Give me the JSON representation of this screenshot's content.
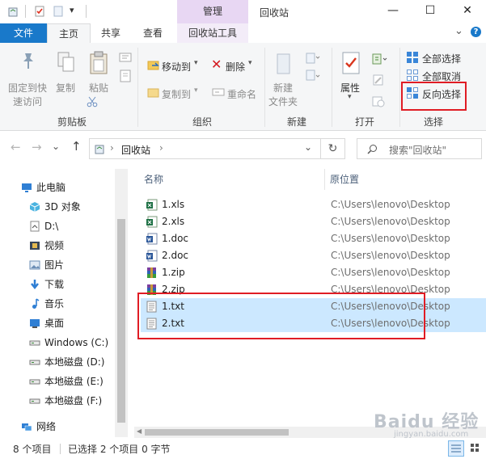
{
  "titlebar": {
    "manage_tab": "管理",
    "window_title": "回收站",
    "dropdown_glyph": "▾",
    "minimize": "—",
    "maximize": "☐",
    "close": "✕"
  },
  "ribbon_tabs": {
    "file": "文件",
    "home": "主页",
    "share": "共享",
    "view": "查看",
    "recycle_tools": "回收站工具",
    "expand_glyph": "⌄",
    "help_glyph": "?"
  },
  "ribbon": {
    "clipboard": {
      "pin": [
        "固定到快",
        "速访问"
      ],
      "copy": "复制",
      "paste": "粘贴",
      "group_label": "剪贴板"
    },
    "organize": {
      "move_to": "移动到",
      "copy_to": "复制到",
      "delete": "删除",
      "rename": "重命名",
      "group_label": "组织"
    },
    "new": {
      "new_folder": [
        "新建",
        "文件夹"
      ],
      "group_label": "新建"
    },
    "open": {
      "properties": "属性",
      "group_label": "打开"
    },
    "select": {
      "select_all": "全部选择",
      "select_none": "全部取消",
      "invert": "反向选择",
      "group_label": "选择"
    }
  },
  "address": {
    "back": "←",
    "forward": "→",
    "recent": "⌄",
    "up": "↑",
    "breadcrumb_sep": "›",
    "location": "回收站",
    "breadcrumb_end": "›",
    "history_dropdown": "⌄",
    "refresh": "↻",
    "search_placeholder": "搜索\"回收站\""
  },
  "nav": {
    "items": [
      {
        "label": "此电脑",
        "icon": "computer-icon"
      },
      {
        "label": "3D 对象",
        "icon": "3d-objects-icon"
      },
      {
        "label": "D:\\",
        "icon": "drive-shortcut-icon"
      },
      {
        "label": "视频",
        "icon": "videos-icon"
      },
      {
        "label": "图片",
        "icon": "pictures-icon"
      },
      {
        "label": "下载",
        "icon": "downloads-icon"
      },
      {
        "label": "音乐",
        "icon": "music-icon"
      },
      {
        "label": "桌面",
        "icon": "desktop-icon"
      },
      {
        "label": "Windows (C:)",
        "icon": "drive-icon"
      },
      {
        "label": "本地磁盘 (D:)",
        "icon": "drive-icon"
      },
      {
        "label": "本地磁盘 (E:)",
        "icon": "drive-icon"
      },
      {
        "label": "本地磁盘 (F:)",
        "icon": "drive-icon"
      },
      {
        "label": "网络",
        "icon": "network-icon"
      }
    ]
  },
  "files": {
    "col_name": "名称",
    "col_location": "原位置",
    "rows": [
      {
        "name": "1.xls",
        "location": "C:\\Users\\lenovo\\Desktop",
        "type": "excel",
        "selected": false
      },
      {
        "name": "2.xls",
        "location": "C:\\Users\\lenovo\\Desktop",
        "type": "excel",
        "selected": false
      },
      {
        "name": "1.doc",
        "location": "C:\\Users\\lenovo\\Desktop",
        "type": "word",
        "selected": false
      },
      {
        "name": "2.doc",
        "location": "C:\\Users\\lenovo\\Desktop",
        "type": "word",
        "selected": false
      },
      {
        "name": "1.zip",
        "location": "C:\\Users\\lenovo\\Desktop",
        "type": "zip",
        "selected": false
      },
      {
        "name": "2.zip",
        "location": "C:\\Users\\lenovo\\Desktop",
        "type": "zip",
        "selected": false
      },
      {
        "name": "1.txt",
        "location": "C:\\Users\\lenovo\\Desktop",
        "type": "text",
        "selected": true
      },
      {
        "name": "2.txt",
        "location": "C:\\Users\\lenovo\\Desktop",
        "type": "text",
        "selected": true
      }
    ]
  },
  "status": {
    "count": "8 个项目",
    "selection": "已选择 2 个项目 0 字节"
  },
  "watermark": {
    "brand": "Baidu 经验",
    "url": "jingyan.baidu.com"
  },
  "colors": {
    "accent": "#1979ca",
    "selection": "#cce8ff",
    "manage_tab": "#e8d7f3",
    "highlight_box": "#e01c24"
  }
}
